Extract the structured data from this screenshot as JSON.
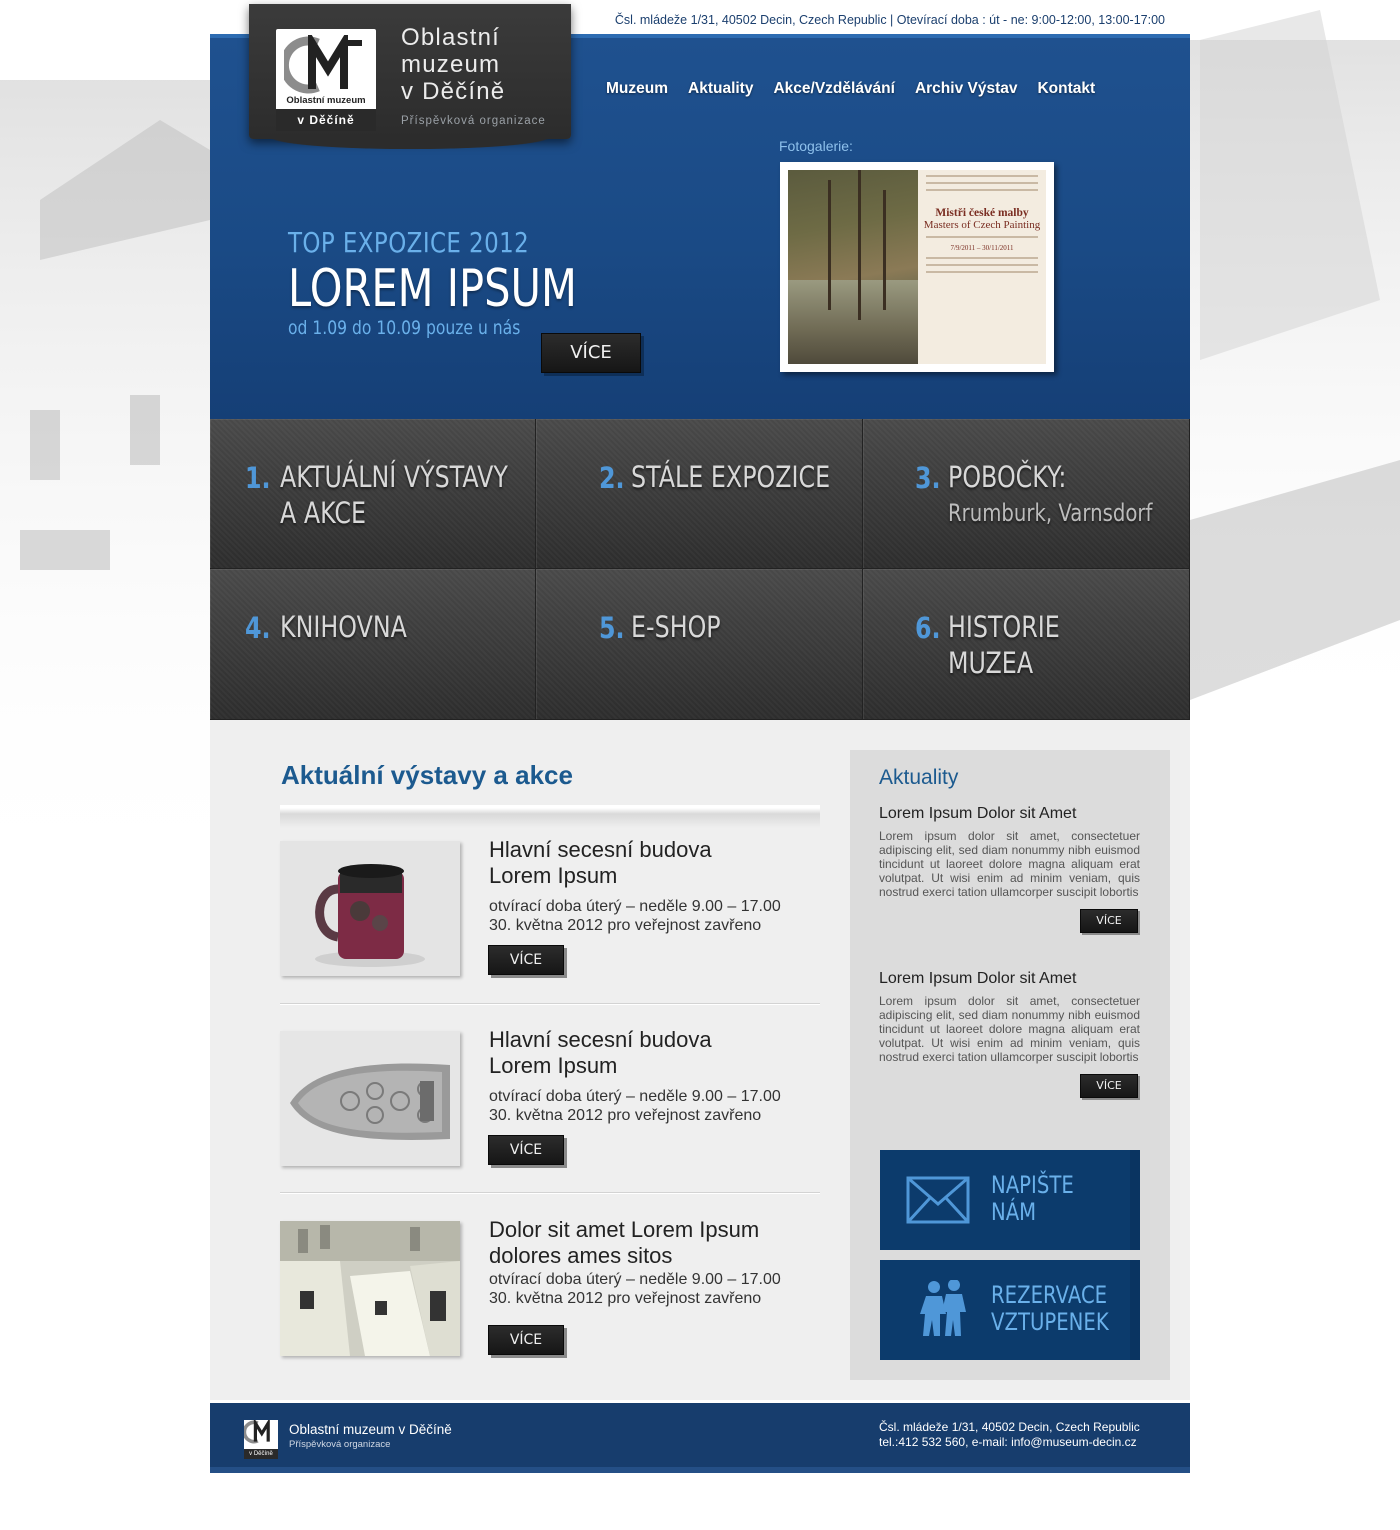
{
  "top_bar": {
    "address": "Čsl. mládeže 1/31, 40502 Decin, Czech Republic | Otevírací doba : út - ne: 9:00-12:00, 13:00-17:00"
  },
  "logo": {
    "badge_name": "Oblastní muzeum",
    "badge_city": "v Děčíně",
    "title_lines": [
      "Oblastní",
      "muzeum",
      "v Děčíně"
    ],
    "subtitle": "Příspěvková organizace"
  },
  "nav": {
    "items": [
      "Muzeum",
      "Aktuality",
      "Akce/Vzdělávání",
      "Archiv Výstav",
      "Kontakt"
    ]
  },
  "hero": {
    "kicker": "TOP EXPOZICE 2012",
    "title": "LOREM IPSUM",
    "dates": "od 1.09 do 10.09 pouze u nás",
    "button": "VÍCE",
    "gallery_label": "Fotogalerie:",
    "gallery_poster_title": "Mistři české malby",
    "gallery_poster_subtitle": "Masters of Czech Painting",
    "gallery_poster_dates": "7/9/2011 – 30/11/2011"
  },
  "tiles": [
    {
      "num": "1.",
      "label_lines": [
        "AKTUÁLNÍ VÝSTAVY",
        "A AKCE"
      ],
      "sub": ""
    },
    {
      "num": "2.",
      "label_lines": [
        "STÁLE EXPOZICE"
      ],
      "sub": ""
    },
    {
      "num": "3.",
      "label_lines": [
        "POBOČKY:"
      ],
      "sub": "Rrumburk, Varnsdorf"
    },
    {
      "num": "4.",
      "label_lines": [
        "KNIHOVNA"
      ],
      "sub": ""
    },
    {
      "num": "5.",
      "label_lines": [
        "E-SHOP"
      ],
      "sub": ""
    },
    {
      "num": "6.",
      "label_lines": [
        "HISTORIE",
        "MUZEA"
      ],
      "sub": ""
    }
  ],
  "events": {
    "title": "Aktuální výstavy a akce",
    "items": [
      {
        "title_lines": [
          "Hlavní secesní budova",
          "Lorem Ipsum"
        ],
        "hours": "otvírací doba úterý – neděle 9.00 – 17.00",
        "note": "30. května 2012 pro veřejnost zavřeno",
        "button": "VÍCE",
        "thumb": "ceramic-mug"
      },
      {
        "title_lines": [
          "Hlavní secesní budova",
          "Lorem Ipsum"
        ],
        "hours": "otvírací doba úterý – neděle 9.00 – 17.00",
        "note": "30. května 2012 pro veřejnost zavřeno",
        "button": "VÍCE",
        "thumb": "iron-plate"
      },
      {
        "title_lines": [
          "Dolor sit amet Lorem Ipsum",
          "dolores ames sitos"
        ],
        "hours": "otvírací doba úterý – neděle 9.00 – 17.00",
        "note": "30. května 2012 pro veřejnost zavřeno",
        "button": "VÍCE",
        "thumb": "exhibition-hall"
      }
    ]
  },
  "news": {
    "title": "Aktuality",
    "items": [
      {
        "head": "Lorem Ipsum Dolor sit Amet",
        "body": "Lorem ipsum dolor sit amet, consectetuer adipiscing elit, sed diam nonummy nibh euismod tincidunt ut laoreet dolore magna aliquam erat volutpat. Ut wisi enim ad minim veniam, quis nostrud exerci tation ullamcorper suscipit lobortis",
        "button": "VÍCE"
      },
      {
        "head": "Lorem Ipsum Dolor sit Amet",
        "body": "Lorem ipsum dolor sit amet, consectetuer adipiscing elit, sed diam nonummy nibh euismod tincidunt ut laoreet dolore magna aliquam erat volutpat. Ut wisi enim ad minim veniam, quis nostrud exerci tation ullamcorper suscipit lobortis",
        "button": "VÍCE"
      }
    ]
  },
  "cta": [
    {
      "label_lines": [
        "NAPIŠTE",
        "NÁM"
      ],
      "icon": "envelope-icon"
    },
    {
      "label_lines": [
        "REZERVACE",
        "VZTUPENEK"
      ],
      "icon": "visitors-icon"
    }
  ],
  "footer": {
    "name": "Oblastní muzeum v Děčíně",
    "sub": "Příspěvková organizace",
    "address": "Čsl. mládeže 1/31, 40502 Decin, Czech Republic",
    "contact": "tel.:412 532 560, e-mail: info@museum-decin.cz",
    "logo_city": "v Děčíně"
  },
  "colors": {
    "navy": "#1a4a85",
    "accent_blue": "#4f97d8",
    "tile_dark": "#3c3c3c",
    "content_bg": "#efefef"
  }
}
